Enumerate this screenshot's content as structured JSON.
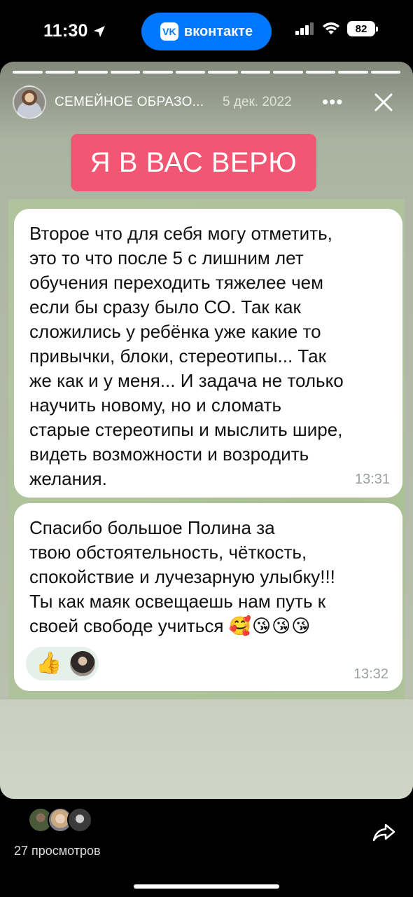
{
  "status_bar": {
    "time": "11:30",
    "app_pill": "вконтакте",
    "app_logo": "VK",
    "battery": "82"
  },
  "story": {
    "author": "СЕМЕЙНОЕ ОБРАЗО...",
    "date": "5 дек. 2022",
    "more_icon": "•••",
    "progress": {
      "total": 12,
      "current": 12
    },
    "sticker": "Я В ВАС ВЕРЮ",
    "messages": [
      {
        "text": "Второе что для себя могу отметить,\nэто то что после 5 с лишним лет\nобучения переходить тяжелее чем\nесли бы сразу было СО. Так как\nсложились у ребёнка уже какие то\nпривычки, блоки, стереотипы... Так\nже как и у меня... И задача не только\nнаучить новому, но и сломать\nстарые стереотипы и мыслить шире,\nвидеть возможности и возродить\nжелания.",
        "time": "13:31"
      },
      {
        "text": "Спасибо большое Полина за\nтвою обстоятельность, чёткость,\nспокойствие и лучезарную улыбку!!!\nТы как маяк освещаешь нам путь к\nсвоей свободе учиться ",
        "emojis": "🥰😘😘😘",
        "reaction": "👍",
        "time": "13:32"
      }
    ]
  },
  "footer": {
    "views": "27 просмотров"
  }
}
